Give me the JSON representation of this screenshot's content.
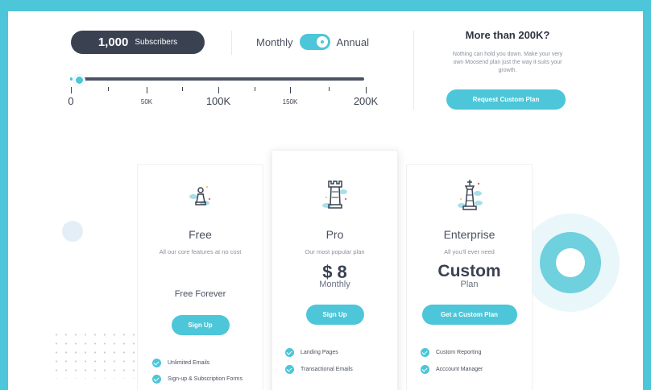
{
  "calculator": {
    "subscribers_value": "1,000",
    "subscribers_label": "Subscribers",
    "billing": {
      "monthly_label": "Monthly",
      "annual_label": "Annual",
      "annual_selected": true
    },
    "slider": {
      "value_fraction": 0.03,
      "ticks_major": [
        "0",
        "100K",
        "200K"
      ],
      "ticks_minor": [
        "50K",
        "150K"
      ]
    }
  },
  "custom_plan": {
    "title": "More than 200K?",
    "description": "Nothing can hold you down. Make your very own Moosend plan just the way it suits your growth.",
    "button_label": "Request Custom Plan"
  },
  "plans": [
    {
      "name": "Free",
      "description": "All our core features at no cost",
      "price_text": "Free Forever",
      "button_label": "Sign Up",
      "icon": "chess-pawn-icon",
      "features": [
        "Unlimited Emails",
        "Sign-up & Subscription Forms"
      ]
    },
    {
      "name": "Pro",
      "description": "Our most popular plan",
      "price": "$ 8",
      "price_period": "Monthly",
      "button_label": "Sign Up",
      "icon": "chess-rook-icon",
      "features": [
        "Landing Pages",
        "Transactional Emails"
      ]
    },
    {
      "name": "Enterprise",
      "description": "All you'll ever need",
      "price": "Custom",
      "price_period": "Plan",
      "button_label": "Get a Custom Plan",
      "icon": "chess-king-icon",
      "features": [
        "Custom Reporting",
        "Acccount Manager"
      ]
    }
  ],
  "colors": {
    "accent": "#4cc6d8",
    "dark": "#3a4252",
    "frame": "#4cc6d8"
  }
}
